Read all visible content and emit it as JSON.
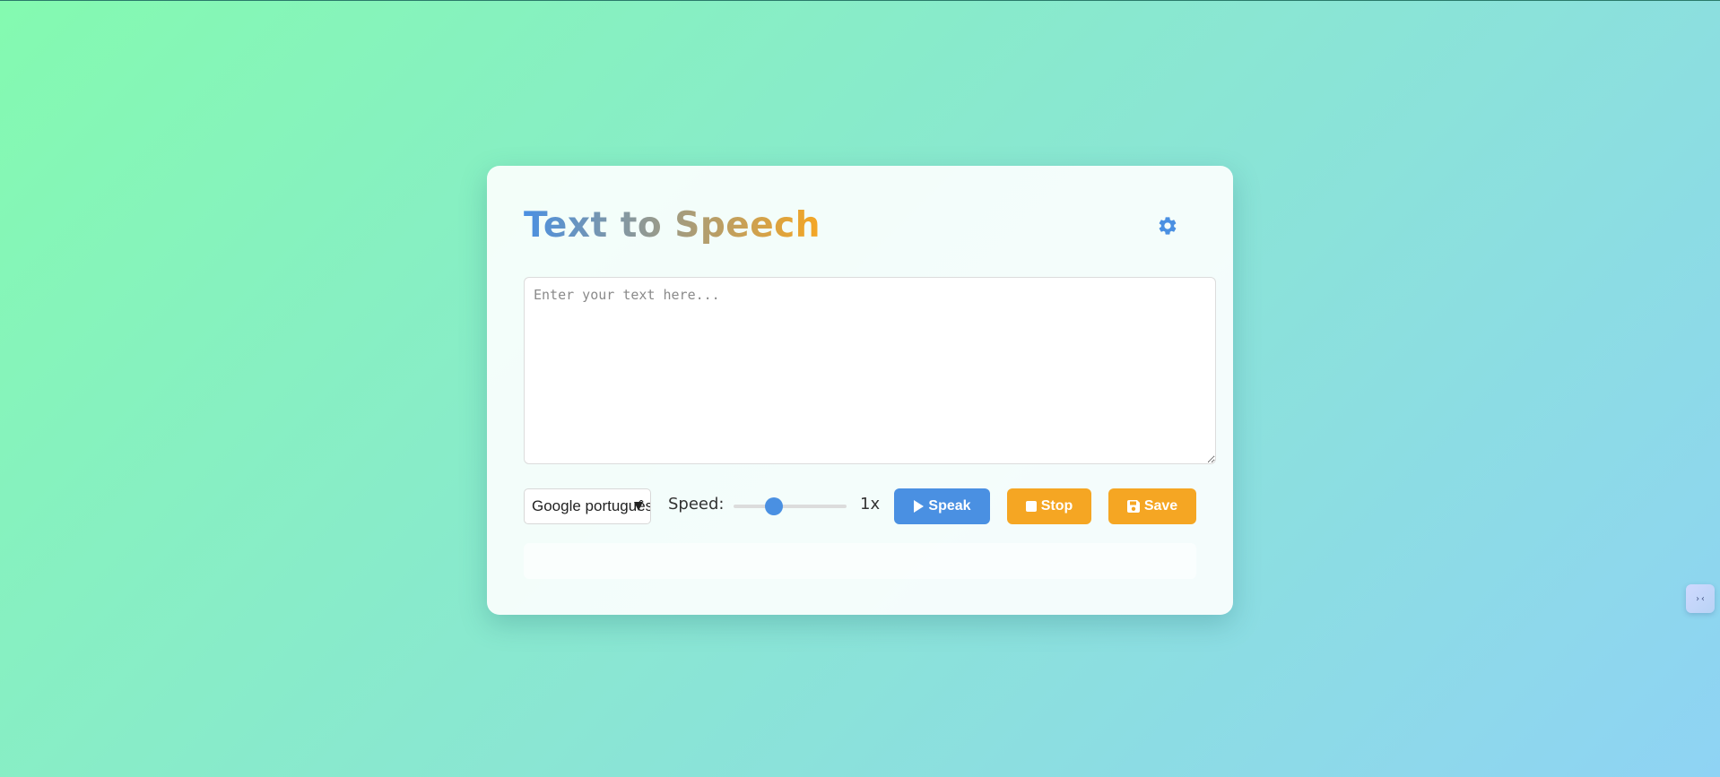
{
  "app": {
    "title": "Text to Speech",
    "gradient_start": "#4a90e2",
    "gradient_end": "#f5a623"
  },
  "header": {
    "settings_icon": "gear-icon"
  },
  "editor": {
    "placeholder": "Enter your text here...",
    "value": ""
  },
  "controls": {
    "voice_selected": "Google português",
    "speed_label": "Speed:",
    "speed_value": "1x",
    "speed_fraction": 0.36,
    "speak_label": "Speak",
    "speak_icon": "play-icon",
    "stop_label": "Stop",
    "stop_icon": "stop-icon",
    "save_label": "Save",
    "save_icon": "save-icon",
    "primary_color": "#4a90e2",
    "accent_color": "#f5a623"
  },
  "status": {
    "message": ""
  },
  "side_widget": {
    "icon": "chevrons-icon",
    "glyph": "›‹"
  }
}
